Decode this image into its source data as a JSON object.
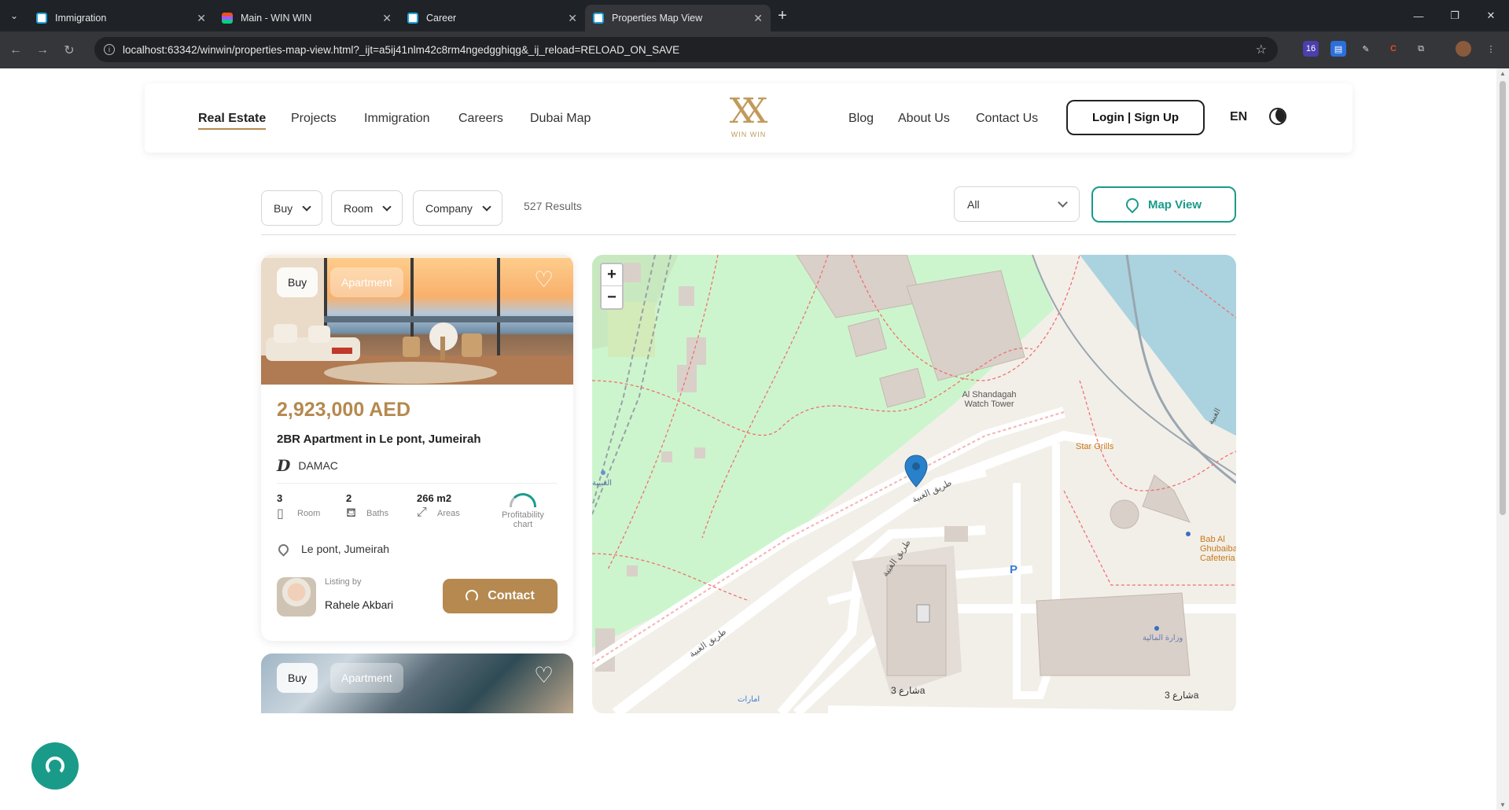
{
  "browser": {
    "tabs": [
      {
        "title": "Immigration",
        "favicon": "webstorm-icon"
      },
      {
        "title": "Main - WIN WIN",
        "favicon": "figma-icon"
      },
      {
        "title": "Career",
        "favicon": "webstorm-icon"
      },
      {
        "title": "Properties Map View",
        "favicon": "webstorm-icon",
        "active": true
      }
    ],
    "url": "localhost:63342/winwin/properties-map-view.html?_ijt=a5ij41nlm42c8rm4ngedgghiqg&_ij_reload=RELOAD_ON_SAVE",
    "extension_badge": "16"
  },
  "header": {
    "nav_left": [
      "Real Estate",
      "Projects",
      "Immigration",
      "Careers",
      "Dubai Map"
    ],
    "logo_text": "WIN WIN",
    "nav_right": [
      "Blog",
      "About Us",
      "Contact Us"
    ],
    "login_label": "Login | Sign Up",
    "language": "EN"
  },
  "filters": {
    "buy_label": "Buy",
    "room_label": "Room",
    "company_label": "Company",
    "results": "527 Results",
    "type_select": "All",
    "map_view_label": "Map View"
  },
  "listings": [
    {
      "tag_type": "Buy",
      "tag_category": "Apartment",
      "price": "2,923,000 AED",
      "title": "2BR Apartment in Le pont, Jumeirah",
      "company": "DAMAC",
      "rooms": "3",
      "rooms_label": "Room",
      "baths": "2",
      "baths_label": "Baths",
      "area": "266 m2",
      "area_label": "Areas",
      "profitability_label": "Profitability chart",
      "location": "Le pont, Jumeirah",
      "listing_by_label": "Listing by",
      "agent": "Rahele Akbari",
      "contact_label": "Contact"
    },
    {
      "tag_type": "Buy",
      "tag_category": "Apartment"
    }
  ],
  "map": {
    "labels": {
      "watch_tower": "Al Shandagah Watch Tower",
      "star_grills": "Star Grills",
      "bab_al": "Bab Al Ghubaiba Cafeteria",
      "road1": "طريق الغبية",
      "road2": "طريق الغبية",
      "road3": "طريق الغبية",
      "street": "شارع 3a",
      "street2": "شارع 3a",
      "ministry": "وزارة المالية",
      "emirates": "امارات",
      "parking": "P",
      "ghubaiba": "الغبيبة",
      "ghubaiba2": "الغبية"
    },
    "zoom_in": "+",
    "zoom_out": "−"
  },
  "colors": {
    "gold": "#b5894f",
    "teal": "#1a9b8a",
    "park": "#cdf5cd",
    "water": "#aad3df"
  }
}
